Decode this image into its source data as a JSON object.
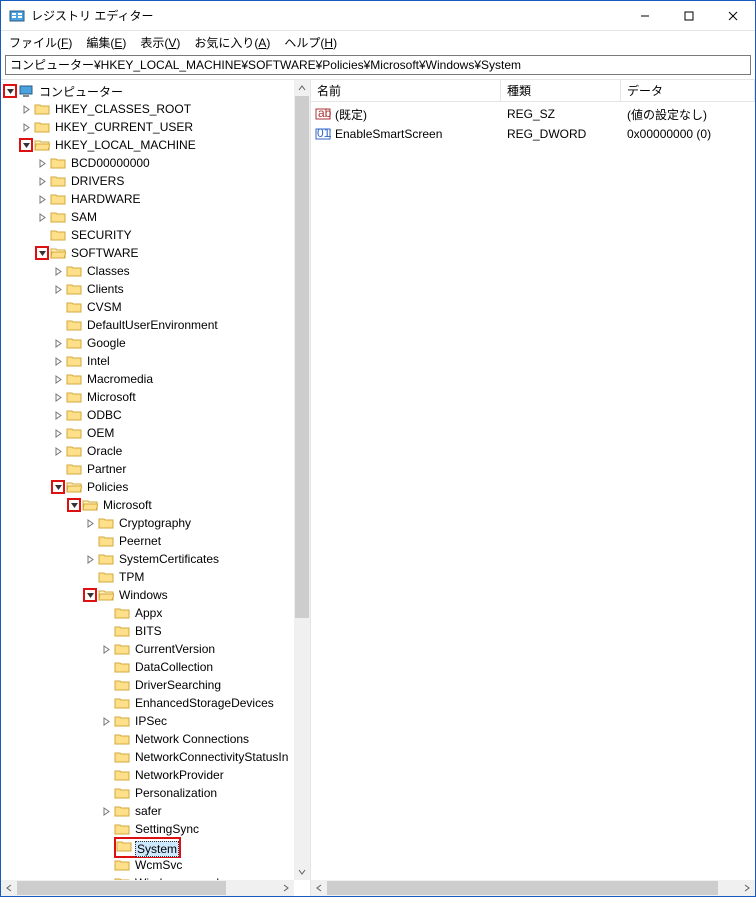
{
  "window": {
    "title": "レジストリ エディター",
    "minimize": "—",
    "maximize": "☐",
    "close": "✕"
  },
  "menu": {
    "file": "ファイル(F)",
    "edit": "編集(E)",
    "view": "表示(V)",
    "favorites": "お気に入り(A)",
    "help": "ヘルプ(H)"
  },
  "address": "コンピューター¥HKEY_LOCAL_MACHINE¥SOFTWARE¥Policies¥Microsoft¥Windows¥System",
  "tree": [
    {
      "d": 0,
      "exp": "open",
      "icon": "computer",
      "label": "コンピューター",
      "hl": true
    },
    {
      "d": 1,
      "exp": "closed",
      "icon": "folder",
      "label": "HKEY_CLASSES_ROOT"
    },
    {
      "d": 1,
      "exp": "closed",
      "icon": "folder",
      "label": "HKEY_CURRENT_USER"
    },
    {
      "d": 1,
      "exp": "open",
      "icon": "folder",
      "label": "HKEY_LOCAL_MACHINE",
      "hl": true
    },
    {
      "d": 2,
      "exp": "closed",
      "icon": "folder",
      "label": "BCD00000000"
    },
    {
      "d": 2,
      "exp": "closed",
      "icon": "folder",
      "label": "DRIVERS"
    },
    {
      "d": 2,
      "exp": "closed",
      "icon": "folder",
      "label": "HARDWARE"
    },
    {
      "d": 2,
      "exp": "closed",
      "icon": "folder",
      "label": "SAM"
    },
    {
      "d": 2,
      "exp": "none",
      "icon": "folder",
      "label": "SECURITY"
    },
    {
      "d": 2,
      "exp": "open",
      "icon": "folder",
      "label": "SOFTWARE",
      "hl": true
    },
    {
      "d": 3,
      "exp": "closed",
      "icon": "folder",
      "label": "Classes"
    },
    {
      "d": 3,
      "exp": "closed",
      "icon": "folder",
      "label": "Clients"
    },
    {
      "d": 3,
      "exp": "none",
      "icon": "folder",
      "label": "CVSM"
    },
    {
      "d": 3,
      "exp": "none",
      "icon": "folder",
      "label": "DefaultUserEnvironment"
    },
    {
      "d": 3,
      "exp": "closed",
      "icon": "folder",
      "label": "Google"
    },
    {
      "d": 3,
      "exp": "closed",
      "icon": "folder",
      "label": "Intel"
    },
    {
      "d": 3,
      "exp": "closed",
      "icon": "folder",
      "label": "Macromedia"
    },
    {
      "d": 3,
      "exp": "closed",
      "icon": "folder",
      "label": "Microsoft"
    },
    {
      "d": 3,
      "exp": "closed",
      "icon": "folder",
      "label": "ODBC"
    },
    {
      "d": 3,
      "exp": "closed",
      "icon": "folder",
      "label": "OEM"
    },
    {
      "d": 3,
      "exp": "closed",
      "icon": "folder",
      "label": "Oracle"
    },
    {
      "d": 3,
      "exp": "none",
      "icon": "folder",
      "label": "Partner"
    },
    {
      "d": 3,
      "exp": "open",
      "icon": "folder",
      "label": "Policies",
      "hl": true
    },
    {
      "d": 4,
      "exp": "open",
      "icon": "folder",
      "label": "Microsoft",
      "hl": true
    },
    {
      "d": 5,
      "exp": "closed",
      "icon": "folder",
      "label": "Cryptography"
    },
    {
      "d": 5,
      "exp": "none",
      "icon": "folder",
      "label": "Peernet"
    },
    {
      "d": 5,
      "exp": "closed",
      "icon": "folder",
      "label": "SystemCertificates"
    },
    {
      "d": 5,
      "exp": "none",
      "icon": "folder",
      "label": "TPM"
    },
    {
      "d": 5,
      "exp": "open",
      "icon": "folder",
      "label": "Windows",
      "hl": true
    },
    {
      "d": 6,
      "exp": "none",
      "icon": "folder",
      "label": "Appx"
    },
    {
      "d": 6,
      "exp": "none",
      "icon": "folder",
      "label": "BITS"
    },
    {
      "d": 6,
      "exp": "closed",
      "icon": "folder",
      "label": "CurrentVersion"
    },
    {
      "d": 6,
      "exp": "none",
      "icon": "folder",
      "label": "DataCollection"
    },
    {
      "d": 6,
      "exp": "none",
      "icon": "folder",
      "label": "DriverSearching"
    },
    {
      "d": 6,
      "exp": "none",
      "icon": "folder",
      "label": "EnhancedStorageDevices"
    },
    {
      "d": 6,
      "exp": "closed",
      "icon": "folder",
      "label": "IPSec"
    },
    {
      "d": 6,
      "exp": "none",
      "icon": "folder",
      "label": "Network Connections"
    },
    {
      "d": 6,
      "exp": "none",
      "icon": "folder",
      "label": "NetworkConnectivityStatusIn"
    },
    {
      "d": 6,
      "exp": "none",
      "icon": "folder",
      "label": "NetworkProvider"
    },
    {
      "d": 6,
      "exp": "none",
      "icon": "folder",
      "label": "Personalization"
    },
    {
      "d": 6,
      "exp": "closed",
      "icon": "folder",
      "label": "safer"
    },
    {
      "d": 6,
      "exp": "none",
      "icon": "folder",
      "label": "SettingSync"
    },
    {
      "d": 6,
      "exp": "none",
      "icon": "folder",
      "label": "System",
      "sel": true,
      "hlLabel": true
    },
    {
      "d": 6,
      "exp": "none",
      "icon": "folder",
      "label": "WcmSvc"
    },
    {
      "d": 6,
      "exp": "none",
      "icon": "folder",
      "label": "Windows search"
    }
  ],
  "columns": {
    "name": "名前",
    "type": "種類",
    "data": "データ"
  },
  "colwidths": {
    "name": 190,
    "type": 120,
    "data": 120
  },
  "values": [
    {
      "icon": "string",
      "name": "(既定)",
      "type": "REG_SZ",
      "data": "(値の設定なし)"
    },
    {
      "icon": "binary",
      "name": "EnableSmartScreen",
      "type": "REG_DWORD",
      "data": "0x00000000 (0)"
    }
  ]
}
